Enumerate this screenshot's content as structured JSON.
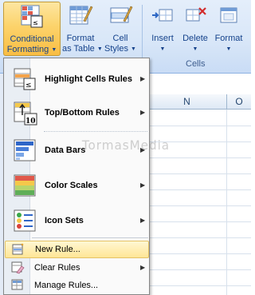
{
  "ribbon": {
    "conditional_formatting": {
      "line1": "Conditional",
      "line2": "Formatting",
      "icon": "conditional-formatting-icon"
    },
    "format_as_table": {
      "line1": "Format",
      "line2": "as Table",
      "icon": "format-as-table-icon"
    },
    "cell_styles": {
      "line1": "Cell",
      "line2": "Styles",
      "icon": "cell-styles-icon"
    },
    "insert": {
      "label": "Insert",
      "icon": "insert-cells-icon"
    },
    "delete": {
      "label": "Delete",
      "icon": "delete-cells-icon"
    },
    "format": {
      "label": "Format",
      "icon": "format-cells-icon"
    },
    "cells_group_label": "Cells"
  },
  "sheet": {
    "columns": [
      "N",
      "O"
    ]
  },
  "menu": {
    "items": [
      {
        "label": "Highlight Cells Rules",
        "has_submenu": true,
        "icon": "highlight-cells-rules-icon"
      },
      {
        "label": "Top/Bottom Rules",
        "has_submenu": true,
        "icon": "top-bottom-rules-icon"
      },
      {
        "label": "Data Bars",
        "has_submenu": true,
        "icon": "data-bars-icon"
      },
      {
        "label": "Color Scales",
        "has_submenu": true,
        "icon": "color-scales-icon"
      },
      {
        "label": "Icon Sets",
        "has_submenu": true,
        "icon": "icon-sets-icon"
      }
    ],
    "small_items": [
      {
        "label": "New Rule...",
        "highlighted": true,
        "icon": "new-rule-icon"
      },
      {
        "label": "Clear Rules",
        "has_submenu": true,
        "icon": "clear-rules-icon"
      },
      {
        "label": "Manage Rules...",
        "icon": "manage-rules-icon"
      }
    ]
  },
  "watermark": "TormasMedia",
  "colors": {
    "ribbon_bg": "#d9e7f8",
    "highlight": "#ffe696",
    "text_blue": "#15428b"
  }
}
